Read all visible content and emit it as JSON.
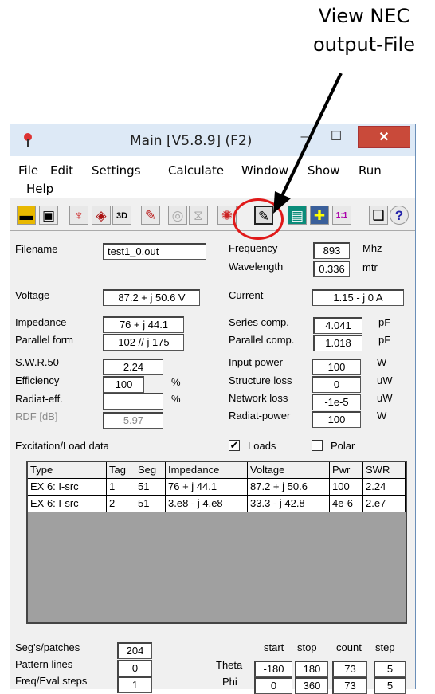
{
  "annotation": {
    "line1": "View NEC",
    "line2": "output-File"
  },
  "window": {
    "title": "Main [V5.8.9]  (F2)",
    "minimize": "–",
    "maximize": "☐",
    "close": "✕"
  },
  "menu": [
    "File",
    "Edit",
    "Settings",
    "Calculate",
    "Window",
    "Show",
    "Run",
    "Help"
  ],
  "toolbar": {
    "icons": [
      "folder-icon",
      "save-icon",
      "antenna-icon",
      "cube-icon",
      "3d-icon",
      "edit-geometry-icon",
      "pattern-icon",
      "slice-icon",
      "far-field-icon",
      "view-output-icon",
      "calculator-icon",
      "smith-chart-icon",
      "scale-icon",
      "book-icon",
      "help-icon"
    ],
    "labels": {
      "3d": "3D",
      "scale": "1:1",
      "help": "?"
    }
  },
  "fields": {
    "filename_label": "Filename",
    "filename": "test1_0.out",
    "frequency_label": "Frequency",
    "frequency": "893",
    "frequency_unit": "Mhz",
    "wavelength_label": "Wavelength",
    "wavelength": "0.336",
    "wavelength_unit": "mtr",
    "voltage_label": "Voltage",
    "voltage": "87.2 + j 50.6 V",
    "current_label": "Current",
    "current": "1.15 - j 0 A",
    "impedance_label": "Impedance",
    "impedance": "76 + j 44.1",
    "parallel_form_label": "Parallel form",
    "parallel_form": "102 // j 175",
    "series_comp_label": "Series comp.",
    "series_comp": "4.041",
    "series_comp_unit": "pF",
    "parallel_comp_label": "Parallel comp.",
    "parallel_comp": "1.018",
    "parallel_comp_unit": "pF",
    "swr_label": "S.W.R.50",
    "swr": "2.24",
    "efficiency_label": "Efficiency",
    "efficiency": "100",
    "efficiency_unit": "%",
    "radiat_eff_label": "Radiat-eff.",
    "radiat_eff": "",
    "radiat_eff_unit": "%",
    "rdf_label": "RDF [dB]",
    "rdf": "5.97",
    "input_power_label": "Input power",
    "input_power": "100",
    "input_power_unit": "W",
    "structure_loss_label": "Structure loss",
    "structure_loss": "0",
    "structure_loss_unit": "uW",
    "network_loss_label": "Network loss",
    "network_loss": "-1e-5",
    "network_loss_unit": "uW",
    "radiat_power_label": "Radiat-power",
    "radiat_power": "100",
    "radiat_power_unit": "W"
  },
  "excitation": {
    "title": "Excitation/Load data",
    "loads_label": "Loads",
    "loads_checked": true,
    "polar_label": "Polar",
    "polar_checked": false,
    "columns": [
      "Type",
      "Tag",
      "Seg",
      "Impedance",
      "Voltage",
      "Pwr",
      "SWR"
    ],
    "rows": [
      [
        "EX 6: I-src",
        "1",
        "51",
        "76 + j 44.1",
        "87.2 + j 50.6",
        "100",
        "2.24"
      ],
      [
        "EX 6: I-src",
        "2",
        "51",
        "3.e8 - j 4.e8",
        "33.3 - j 42.8",
        "4e-6",
        "2.e7"
      ]
    ]
  },
  "bottom": {
    "segs_label": "Seg's/patches",
    "segs": "204",
    "pattern_lines_label": "Pattern lines",
    "pattern_lines": "0",
    "freq_eval_label": "Freq/Eval steps",
    "freq_eval": "1",
    "headers": [
      "start",
      "stop",
      "count",
      "step"
    ],
    "theta_label": "Theta",
    "theta": [
      "-180",
      "180",
      "73",
      "5"
    ],
    "phi_label": "Phi",
    "phi": [
      "0",
      "360",
      "73",
      "5"
    ]
  }
}
